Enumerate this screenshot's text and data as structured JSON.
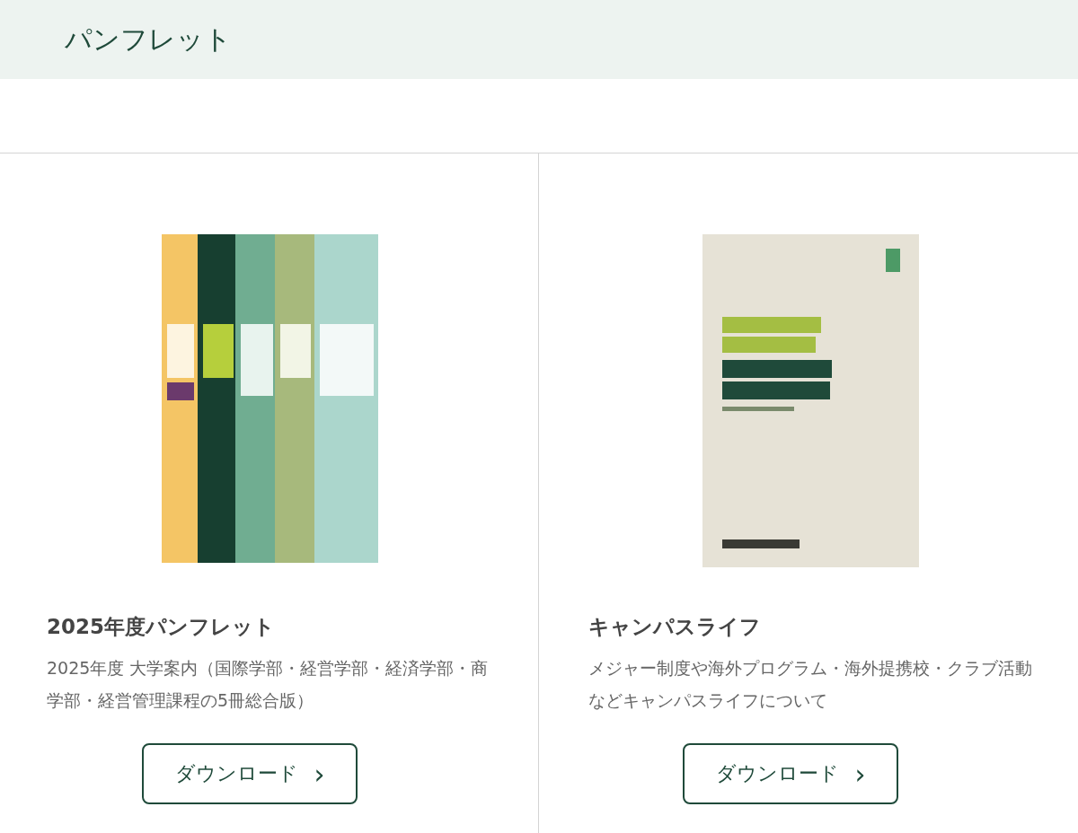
{
  "header": {
    "title": "パンフレット"
  },
  "pamphlets": [
    {
      "title": "2025年度パンフレット",
      "description": "2025年度 大学案内（国際学部・経営学部・経済学部・商学部・経営管理課程の5冊総合版）",
      "button": {
        "label": "ダウンロード",
        "icon": "›"
      }
    },
    {
      "title": "キャンパスライフ",
      "description": "メジャー制度や海外プログラム・海外提携校・クラブ活動などキャンパスライフについて",
      "button": {
        "label": "ダウンロード",
        "icon": "›"
      }
    }
  ]
}
